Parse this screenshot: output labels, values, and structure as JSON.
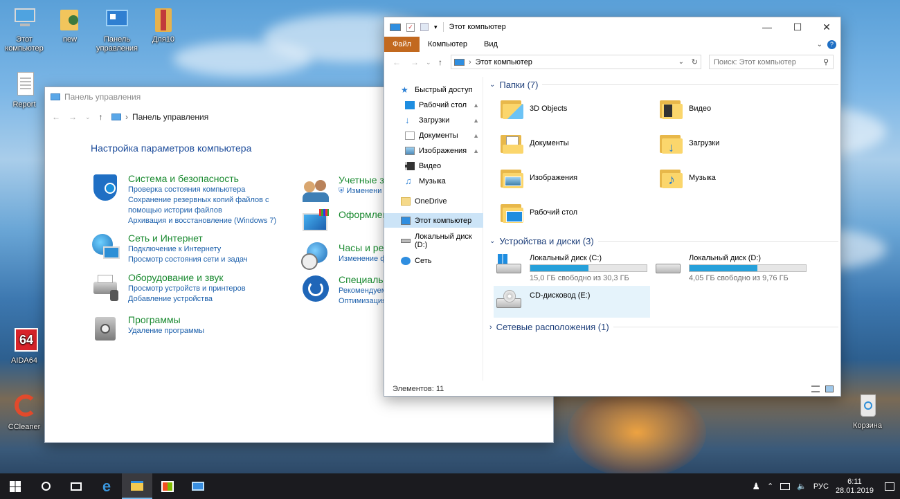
{
  "colors": {
    "accent": "#c2691f",
    "link": "#1b5fab",
    "category": "#1a8a30",
    "heading": "#1e4d9b",
    "drive_fill": "#26a0da",
    "selection": "#cce4f7"
  },
  "desktop": {
    "icons": [
      {
        "label": "Этот компьютер",
        "icon": "computer-icon"
      },
      {
        "label": "new",
        "icon": "user-folder-icon"
      },
      {
        "label": "Панель управления",
        "icon": "control-panel-icon"
      },
      {
        "label": "Для10",
        "icon": "archive-icon"
      },
      {
        "label": "Report",
        "icon": "document-icon"
      },
      {
        "label": "AIDA64",
        "icon": "aida64-icon"
      },
      {
        "label": "CCleaner",
        "icon": "ccleaner-icon"
      },
      {
        "label": "Корзина",
        "icon": "recycle-bin-icon"
      }
    ]
  },
  "control_panel": {
    "title": "Панель управления",
    "breadcrumb": "Панель управления",
    "heading": "Настройка параметров компьютера",
    "categories": [
      {
        "title": "Система и безопасность",
        "icon": "shield-icon",
        "links": [
          "Проверка состояния компьютера",
          "Сохранение резервных копий файлов с",
          "помощью истории файлов",
          "Архивация и восстановление (Windows 7)"
        ]
      },
      {
        "title": "Сеть и Интернет",
        "icon": "network-globe-icon",
        "links": [
          "Подключение к Интернету",
          "Просмотр состояния сети и задач"
        ]
      },
      {
        "title": "Оборудование и звук",
        "icon": "printer-icon",
        "links": [
          "Просмотр устройств и принтеров",
          "Добавление устройства"
        ]
      },
      {
        "title": "Программы",
        "icon": "programs-icon",
        "links": [
          "Удаление программы"
        ]
      },
      {
        "title": "Учетные з",
        "icon": "users-icon",
        "links": [
          "Изменени"
        ]
      },
      {
        "title": "Оформлен",
        "icon": "appearance-icon",
        "links": []
      },
      {
        "title": "Часы и ре",
        "icon": "clock-globe-icon",
        "links": [
          "Изменение ф"
        ]
      },
      {
        "title": "Специаль",
        "icon": "accessibility-icon",
        "links": [
          "Рекомендуем",
          "Оптимизация"
        ]
      }
    ]
  },
  "explorer": {
    "title": "Этот компьютер",
    "ribbon_tabs": [
      "Файл",
      "Компьютер",
      "Вид"
    ],
    "address": "Этот компьютер",
    "search_placeholder": "Поиск: Этот компьютер",
    "nav": [
      {
        "label": "Быстрый доступ",
        "icon": "star-icon",
        "pinned": false
      },
      {
        "label": "Рабочий стол",
        "icon": "desktop-icon",
        "pinned": true
      },
      {
        "label": "Загрузки",
        "icon": "download-icon",
        "pinned": true
      },
      {
        "label": "Документы",
        "icon": "documents-icon",
        "pinned": true
      },
      {
        "label": "Изображения",
        "icon": "pictures-icon",
        "pinned": true
      },
      {
        "label": "Видео",
        "icon": "video-icon",
        "pinned": false
      },
      {
        "label": "Музыка",
        "icon": "music-icon",
        "pinned": false
      },
      {
        "label": "OneDrive",
        "icon": "onedrive-icon",
        "pinned": false
      },
      {
        "label": "Этот компьютер",
        "icon": "computer-icon",
        "pinned": false
      },
      {
        "label": "Локальный диск (D:)",
        "icon": "drive-icon",
        "pinned": false
      },
      {
        "label": "Сеть",
        "icon": "network-icon",
        "pinned": false
      }
    ],
    "folders_group": "Папки (7)",
    "folders": [
      {
        "name": "3D Objects",
        "icon": "3d-objects-icon"
      },
      {
        "name": "Видео",
        "icon": "video-folder-icon"
      },
      {
        "name": "Документы",
        "icon": "documents-folder-icon"
      },
      {
        "name": "Загрузки",
        "icon": "downloads-folder-icon"
      },
      {
        "name": "Изображения",
        "icon": "pictures-folder-icon"
      },
      {
        "name": "Музыка",
        "icon": "music-folder-icon"
      },
      {
        "name": "Рабочий стол",
        "icon": "desktop-folder-icon"
      }
    ],
    "devices_group": "Устройства и диски (3)",
    "drives": [
      {
        "name": "Локальный диск (C:)",
        "free": "15,0 ГБ свободно из 30,3 ГБ",
        "used_fraction": 0.5
      },
      {
        "name": "Локальный диск (D:)",
        "free": "4,05 ГБ свободно из 9,76 ГБ",
        "used_fraction": 0.585
      },
      {
        "name": "CD-дисковод (E:)",
        "free": "",
        "used_fraction": null
      }
    ],
    "network_group": "Сетевые расположения (1)",
    "status": "Элементов: 11"
  },
  "taskbar": {
    "tray": {
      "language": "РУС",
      "time": "6:11",
      "date": "28.01.2019"
    }
  }
}
